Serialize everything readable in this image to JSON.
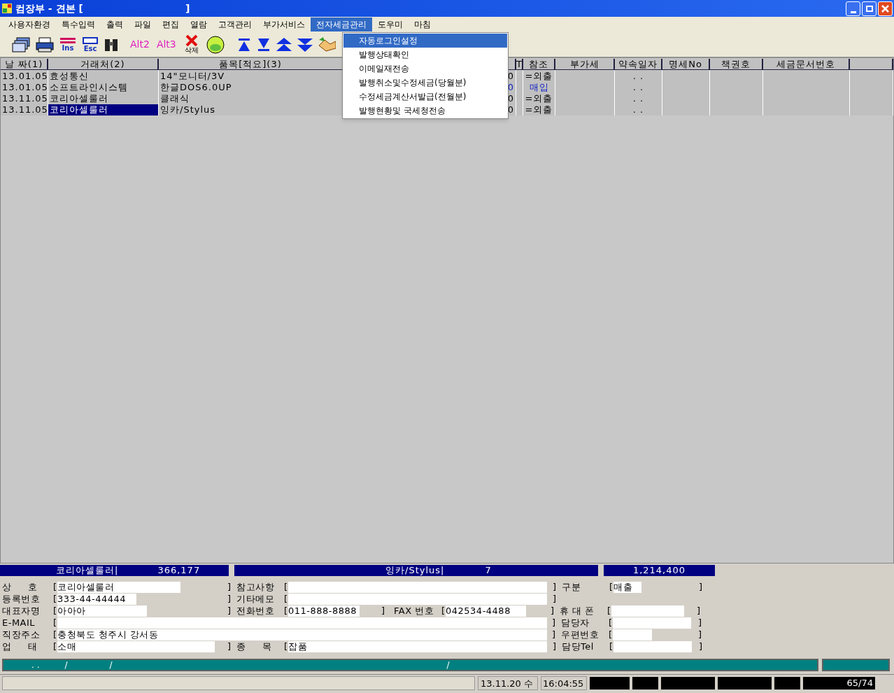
{
  "window": {
    "title": "컴장부 - 견본 [                              ]"
  },
  "menu": [
    {
      "label": "사용자환경",
      "selected": false
    },
    {
      "label": "특수입력",
      "selected": false
    },
    {
      "label": "출력",
      "selected": false
    },
    {
      "label": "파일",
      "selected": false
    },
    {
      "label": "편집",
      "selected": false
    },
    {
      "label": "열람",
      "selected": false
    },
    {
      "label": "고객관리",
      "selected": false
    },
    {
      "label": "부가서비스",
      "selected": false
    },
    {
      "label": "전자세금관리",
      "selected": true
    },
    {
      "label": "도우미",
      "selected": false
    },
    {
      "label": "마침",
      "selected": false
    }
  ],
  "dropdown": [
    {
      "label": "자동로그인설정",
      "selected": true
    },
    {
      "label": "발행상태확인",
      "selected": false
    },
    {
      "label": "이메일재전송",
      "selected": false
    },
    {
      "label": "발행취소및수정세금(당월분)",
      "selected": false
    },
    {
      "label": "수정세금계산서발급(전월분)",
      "selected": false
    },
    {
      "label": "발행현황및 국세청전송",
      "selected": false
    }
  ],
  "toolbar": {
    "ins": "Ins",
    "esc": "Esc",
    "alt2": "Alt2",
    "alt3": "Alt3",
    "delete": "삭제"
  },
  "table": {
    "columns": [
      {
        "label": "날 짜(1)"
      },
      {
        "label": "거래처(2)"
      },
      {
        "label": "품목[적요](3)"
      },
      {},
      {
        "label": "T"
      },
      {
        "label": "참조"
      },
      {
        "label": "부가세"
      },
      {
        "label": "약속일자"
      },
      {
        "label": "명세No"
      },
      {
        "label": "책권호"
      },
      {
        "label": "세금문서번호"
      },
      {}
    ],
    "rows": [
      {
        "color": "#000000",
        "selected": false,
        "cells": [
          "13.01.05",
          "효성통신",
          "14\"모니터/3V",
          "0",
          null,
          "=외출",
          null,
          ". .",
          null,
          null,
          null,
          null
        ]
      },
      {
        "color": "#1020c0",
        "selected": false,
        "cells": [
          "13.01.05",
          "소프트라인시스템",
          "한글DOS6.0UP",
          "0",
          null,
          "매입",
          null,
          ". .",
          null,
          null,
          null,
          null
        ]
      },
      {
        "color": "#000000",
        "selected": false,
        "cells": [
          "13.11.05",
          "코리아셀룰러",
          "클래식",
          "0",
          null,
          "=외출",
          null,
          ". .",
          null,
          null,
          null,
          null
        ]
      },
      {
        "color": "#000000",
        "selected": true,
        "cells": [
          "13.11.05",
          "코리아셀룰러",
          "잉카/Stylus",
          "0",
          null,
          "=외출",
          null,
          ". .",
          null,
          null,
          null,
          null
        ]
      }
    ]
  },
  "summary": [
    {
      "name": "코리아셀룰러|",
      "value": "366,177"
    },
    {
      "name": "잉카/Stylus|",
      "value": "7"
    },
    {
      "value": "1,214,400"
    }
  ],
  "form": {
    "open": "[",
    "close": "]",
    "rows": [
      [
        {
          "label": "상     호",
          "value": "코리아셀룰러"
        },
        {
          "label": "참고사항"
        },
        {
          "label": "구분",
          "value": "매출"
        }
      ],
      [
        {
          "label": "등록번호",
          "value": "333-44-44444"
        },
        {
          "label": "기타메모"
        }
      ],
      [
        {
          "label": "대표자명",
          "value": "아아아"
        },
        {
          "label": "전화번호",
          "value": "011-888-8888"
        },
        {
          "label": "FAX 번호",
          "value": "042534-4488"
        },
        {
          "label": "휴 대 폰"
        }
      ],
      [
        {
          "label": "E-MAIL"
        },
        {
          "label": "담당자"
        }
      ],
      [
        {
          "label": "직장주소",
          "value": "충청북도 청주시 강서동"
        },
        {
          "label": "우편번호"
        }
      ],
      [
        {
          "label": "업     태",
          "value": "소매"
        },
        {
          "label": "종     목",
          "value": "잡품"
        },
        {
          "label": "담당Tel"
        }
      ]
    ]
  },
  "progress": {
    "marks": [
      ". .",
      "/",
      "/",
      "/"
    ]
  },
  "status_bar": {
    "date": "13.11.20 수",
    "time": "16:04:55",
    "count": "65/74"
  }
}
